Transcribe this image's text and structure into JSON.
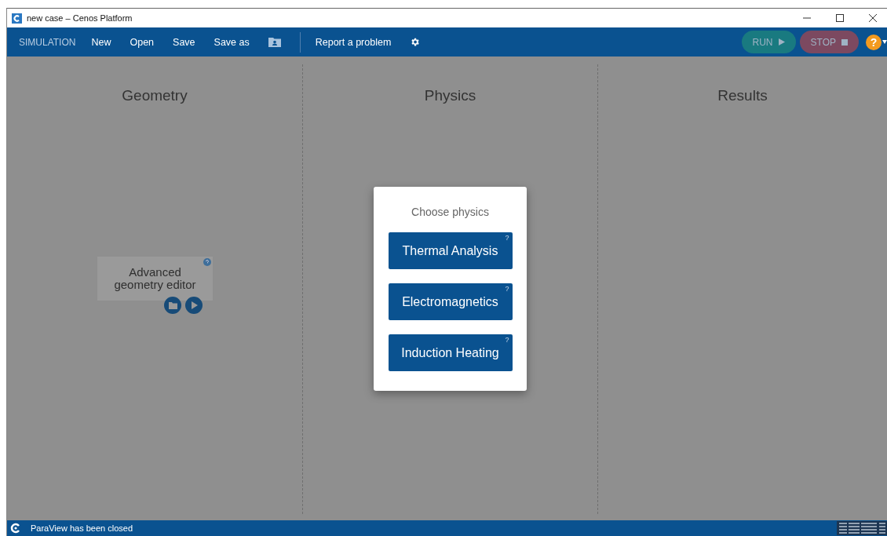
{
  "window": {
    "title": "new case – Cenos Platform"
  },
  "toolbar": {
    "section": "SIMULATION",
    "items": [
      {
        "kind": "text",
        "label": "New"
      },
      {
        "kind": "text",
        "label": "Open"
      },
      {
        "kind": "text",
        "label": "Save"
      },
      {
        "kind": "text",
        "label": "Save as"
      },
      {
        "kind": "icon"
      },
      {
        "kind": "divider"
      },
      {
        "kind": "text",
        "label": "Report a problem"
      },
      {
        "kind": "gear"
      }
    ],
    "run": {
      "label": "RUN",
      "disabled": true
    },
    "stop": {
      "label": "STOP",
      "disabled": true
    },
    "help": "?"
  },
  "columns": [
    {
      "title": "Geometry"
    },
    {
      "title": "Physics"
    },
    {
      "title": "Results"
    }
  ],
  "geometry_card": {
    "label": "Advanced geometry editor"
  },
  "dialog": {
    "title": "Choose physics",
    "options": [
      {
        "label": "Thermal Analysis",
        "help": "?"
      },
      {
        "label": "Electromagnetics",
        "help": "?"
      },
      {
        "label": "Induction Heating",
        "help": "?"
      }
    ]
  },
  "status_bar": {
    "message": "ParaView has been closed"
  }
}
